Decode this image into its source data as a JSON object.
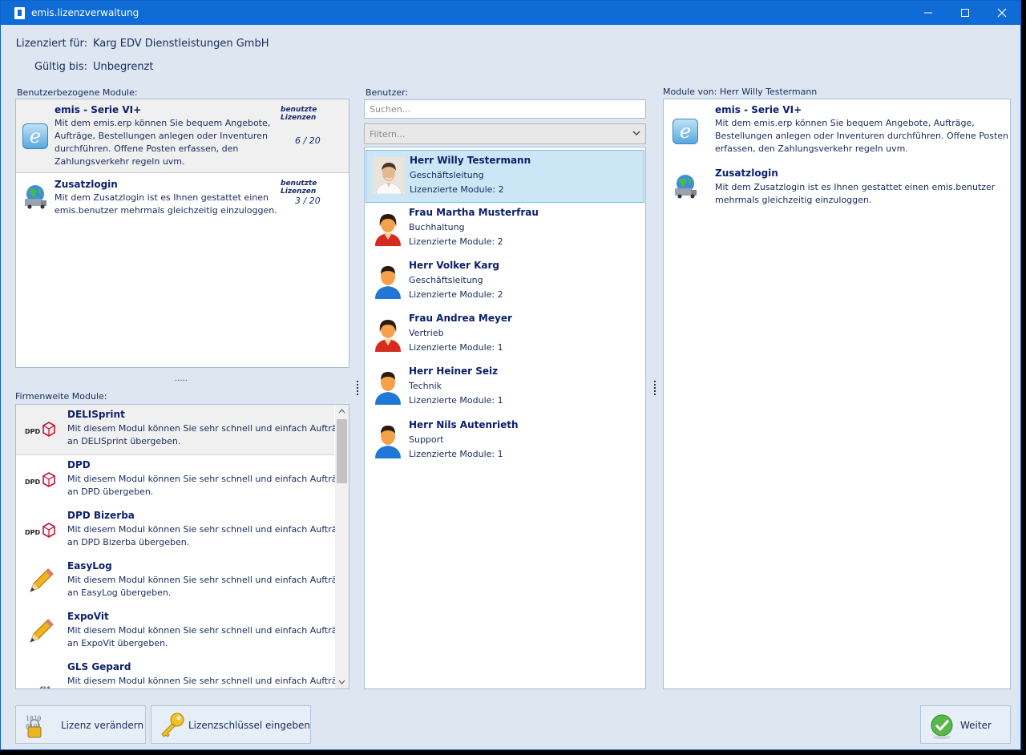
{
  "window": {
    "title": "emis.lizenzverwaltung"
  },
  "license": {
    "licensed_for_label": "Lizenziert für:",
    "licensed_for_value": "Karg EDV Dienstleistungen GmbH",
    "valid_until_label": "Gültig bis:",
    "valid_until_value": "Unbegrenzt"
  },
  "user_modules": {
    "label": "Benutzerbezogene Module:",
    "items": [
      {
        "title": "emis - Serie VI+",
        "desc_lines": [
          "Mit dem emis.erp können Sie bequem Angebote,",
          "Aufträge, Bestellungen anlegen oder Inventuren",
          "durchführen. Offene Posten erfassen, den",
          "Zahlungsverkehr regeln uvm."
        ],
        "used_label": "benutzte Lizenzen",
        "used_value": "6 / 20",
        "icon": "emis-e-icon"
      },
      {
        "title": "Zusatzlogin",
        "desc_lines": [
          "Mit dem Zusatzlogin ist es Ihnen gestattet einen",
          "emis.benutzer mehrmals gleichzeitig einzuloggen."
        ],
        "used_label": "benutzte Lizenzen",
        "used_value": "3 / 20",
        "icon": "globe-truck-icon"
      }
    ]
  },
  "splitter_h": ".....",
  "company_modules": {
    "label": "Firmenweite Module:",
    "items": [
      {
        "title": "DELISprint",
        "line1": "Mit diesem Modul können Sie sehr schnell und einfach Aufträg",
        "line2": "an DELISprint übergeben.",
        "icon": "dpd-icon"
      },
      {
        "title": "DPD",
        "line1": "Mit diesem Modul können Sie sehr schnell und einfach Aufträg",
        "line2": "an DPD übergeben.",
        "icon": "dpd-icon"
      },
      {
        "title": "DPD Bizerba",
        "line1": "Mit diesem Modul können Sie sehr schnell und einfach Aufträg",
        "line2": "an DPD Bizerba übergeben.",
        "icon": "dpd-icon"
      },
      {
        "title": "EasyLog",
        "line1": "Mit diesem Modul können Sie sehr schnell und einfach Aufträg",
        "line2": "an EasyLog übergeben.",
        "icon": "pencil-icon"
      },
      {
        "title": "ExpoVit",
        "line1": "Mit diesem Modul können Sie sehr schnell und einfach Aufträg",
        "line2": "an ExpoVit übergeben.",
        "icon": "pencil-icon"
      },
      {
        "title": "GLS Gepard",
        "line1": "Mit diesem Modul können Sie sehr schnell und einfach Aufträg",
        "line2": "",
        "icon": "gls-icon"
      }
    ]
  },
  "users": {
    "label": "Benutzer:",
    "search_placeholder": "Suchen...",
    "filter_placeholder": "Filtern...",
    "items": [
      {
        "name": "Herr Willy Testermann",
        "role": "Geschäftsleitung",
        "modules": "Lizenzierte Module: 2",
        "avatar": "photo"
      },
      {
        "name": "Frau Martha Musterfrau",
        "role": "Buchhaltung",
        "modules": "Lizenzierte Module: 2",
        "avatar": "female"
      },
      {
        "name": "Herr Volker Karg",
        "role": "Geschäftsleitung",
        "modules": "Lizenzierte Module: 2",
        "avatar": "male"
      },
      {
        "name": "Frau Andrea Meyer",
        "role": "Vertrieb",
        "modules": "Lizenzierte Module: 1",
        "avatar": "female"
      },
      {
        "name": "Herr Heiner Seiz",
        "role": "Technik",
        "modules": "Lizenzierte Module: 1",
        "avatar": "male"
      },
      {
        "name": "Herr Nils Autenrieth",
        "role": "Support",
        "modules": "Lizenzierte Module: 1",
        "avatar": "male"
      }
    ]
  },
  "user_detail": {
    "label": "Module von: Herr Willy Testermann",
    "items": [
      {
        "title": "emis - Serie VI+",
        "desc_lines": [
          "Mit dem emis.erp können Sie bequem Angebote, Aufträge,",
          "Bestellungen anlegen oder Inventuren durchführen. Offene Posten",
          "erfassen, den Zahlungsverkehr regeln uvm."
        ]
      },
      {
        "title": "Zusatzlogin",
        "desc_lines": [
          "Mit dem Zusatzlogin ist es Ihnen gestattet einen emis.benutzer",
          "mehrmals gleichzeitig einzuloggen."
        ]
      }
    ]
  },
  "buttons": {
    "change_license": "Lizenz verändern",
    "enter_key": "Lizenzschlüssel eingeben",
    "next": "Weiter"
  },
  "colors": {
    "titlebar": "#0f6bd6",
    "window_bg": "#dde6f1",
    "selection": "#cce6f6",
    "title_text": "#0b1f6b"
  }
}
